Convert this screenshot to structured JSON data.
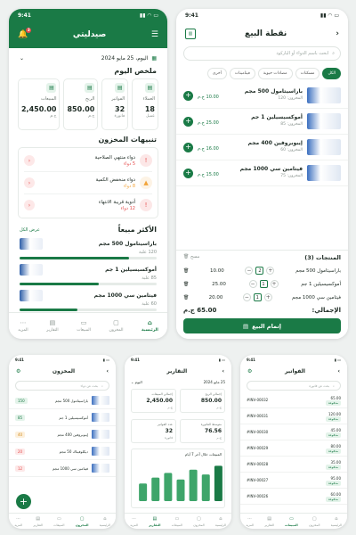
{
  "colors": {
    "primary": "#1a7a46",
    "danger": "#e54b4b",
    "warning": "#f2a43a"
  },
  "status_time": "9:41",
  "dashboard": {
    "title": "صيدليتي",
    "date": "اليوم، 25 مايو 2024",
    "summary_title": "ملخص اليوم",
    "cards": [
      {
        "label": "العملاء",
        "value": "18",
        "unit": "عميل",
        "icon": "users-icon"
      },
      {
        "label": "الفواتير",
        "value": "32",
        "unit": "فاتورة",
        "icon": "invoice-icon"
      },
      {
        "label": "الربح",
        "value": "850.00",
        "unit": "ج.م",
        "icon": "chart-icon"
      },
      {
        "label": "المبيعات",
        "value": "2,450.00",
        "unit": "ج.م",
        "icon": "chart-icon"
      }
    ],
    "alerts_title": "تنبيهات المخزون",
    "alerts": [
      {
        "text": "دواء منتهي الصلاحية",
        "sub": "5 دواء",
        "color": "#e54b4b",
        "icon": "alert-icon"
      },
      {
        "text": "دواء منخفض الكمية",
        "sub": "8 دواء",
        "color": "#f2a43a",
        "icon": "warning-icon"
      },
      {
        "text": "أدوية قريبة الانتهاء",
        "sub": "12 دواء",
        "color": "#e54b4b",
        "icon": "clock-icon"
      }
    ],
    "top_title": "الأكثر مبيعاً",
    "top_link": "عرض الكل",
    "top": [
      {
        "name": "باراسيتامول 500 مجم",
        "units": "120 علبة",
        "pct": 80
      },
      {
        "name": "أموكسيسيلين 1 جم",
        "units": "85 علبة",
        "pct": 58
      },
      {
        "name": "فيتامين سي 1000 مجم",
        "units": "60 علبة",
        "pct": 42
      }
    ],
    "tabs": [
      {
        "label": "الرئيسية",
        "icon": "home-icon",
        "active": true
      },
      {
        "label": "المخزون",
        "icon": "box-icon"
      },
      {
        "label": "المبيعات",
        "icon": "cart-icon"
      },
      {
        "label": "التقارير",
        "icon": "report-icon"
      },
      {
        "label": "المزيد",
        "icon": "more-icon"
      }
    ]
  },
  "pos": {
    "title": "نقطة البيع",
    "search_placeholder": "ابحث باسم الدواء أو الباركود",
    "chips": [
      "الكل",
      "مسكنات",
      "مضادات حيوية",
      "فيتامينات",
      "أخرى"
    ],
    "products": [
      {
        "name": "باراسيتامول 500 مجم",
        "code": "المخزون: 120",
        "price": "10.00 ج.م"
      },
      {
        "name": "أموكسيسيلين 1 جم",
        "code": "المخزون: 85",
        "price": "25.00 ج.م"
      },
      {
        "name": "إيبوبروفين 400 مجم",
        "code": "المخزون: 60",
        "price": "16.00 ج.م"
      },
      {
        "name": "فيتامين سي 1000 مجم",
        "code": "المخزون: 75",
        "price": "15.00 ج.م"
      }
    ],
    "cart_title": "المنتجات (3)",
    "clear": "مسح",
    "cart": [
      {
        "name": "باراسيتامول 500 مجم",
        "qty": "2",
        "total": "10.00"
      },
      {
        "name": "أموكسيسيلين 1 جم",
        "qty": "1",
        "total": "25.00"
      },
      {
        "name": "فيتامين سي 1000 مجم",
        "qty": "1",
        "total": "20.00"
      }
    ],
    "total_label": "الإجمالي:",
    "total": "65.00 ج.م",
    "pay": "إتمام البيع"
  },
  "inventory": {
    "title": "المخزون",
    "search": "بحث عن دواء",
    "rows": [
      {
        "name": "باراسيتامول 500 مجم",
        "qty": "150",
        "color": "#e4f3ea",
        "fg": "#1a7a46"
      },
      {
        "name": "أموكسيسيلين 1 جم",
        "qty": "85",
        "color": "#e4f3ea",
        "fg": "#1a7a46"
      },
      {
        "name": "إيبوبروفين 400 مجم",
        "qty": "40",
        "color": "#fdf0dc",
        "fg": "#d08a1c"
      },
      {
        "name": "ديكلوفيناك 50 مجم",
        "qty": "20",
        "color": "#fde8e8",
        "fg": "#e54b4b"
      },
      {
        "name": "فيتامين سي 1000 مجم",
        "qty": "12",
        "color": "#fde8e8",
        "fg": "#e54b4b"
      }
    ]
  },
  "reports": {
    "title": "التقارير",
    "date": "25 مايو 2024",
    "period": "اليوم",
    "cards": [
      {
        "label": "إجمالي الربح",
        "value": "850.00",
        "unit": "ج.م"
      },
      {
        "label": "إجمالي المبيعات",
        "value": "2,450.00",
        "unit": "ج.م"
      }
    ],
    "cards2": [
      {
        "label": "متوسط الفاتورة",
        "value": "76.56",
        "unit": "ج.م"
      },
      {
        "label": "عدد الفواتير",
        "value": "32",
        "unit": "فاتورة"
      }
    ],
    "chart_title": "المبيعات خلال آخر 7 أيام",
    "chart_data": {
      "type": "bar",
      "categories": [
        "1",
        "2",
        "3",
        "4",
        "5",
        "6",
        "7"
      ],
      "values": [
        45,
        60,
        72,
        55,
        80,
        68,
        90
      ],
      "title": "المبيعات خلال آخر 7 أيام"
    }
  },
  "invoices": {
    "title": "الفواتير",
    "search": "بحث عن فاتورة",
    "rows": [
      {
        "id": "#INV-00032",
        "amount": "65.00",
        "status": "مدفوعة"
      },
      {
        "id": "#INV-00031",
        "amount": "120.00",
        "status": "مدفوعة"
      },
      {
        "id": "#INV-00030",
        "amount": "45.00",
        "status": "مدفوعة"
      },
      {
        "id": "#INV-00029",
        "amount": "80.00",
        "status": "مدفوعة"
      },
      {
        "id": "#INV-00028",
        "amount": "35.00",
        "status": "مدفوعة"
      },
      {
        "id": "#INV-00027",
        "amount": "95.00",
        "status": "مدفوعة"
      },
      {
        "id": "#INV-00026",
        "amount": "60.00",
        "status": "مدفوعة"
      }
    ]
  }
}
